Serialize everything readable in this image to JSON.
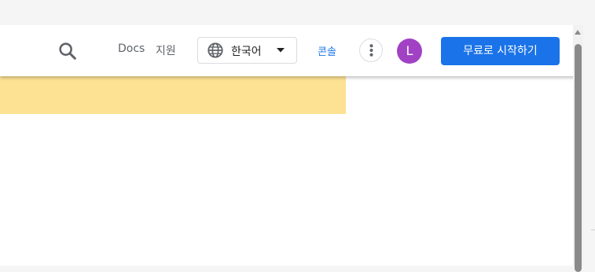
{
  "header": {
    "nav": {
      "docs": "Docs",
      "support": "지원"
    },
    "language": {
      "selected": "한국어"
    },
    "console": "콘솔",
    "avatar_initial": "L",
    "cta": "무료로 시작하기"
  },
  "colors": {
    "accent": "#1a73e8",
    "avatar_bg": "#a142c4",
    "banner_bg": "#fde293"
  },
  "icons": [
    "search-icon",
    "globe-icon",
    "caret-down-icon",
    "more-vert-icon"
  ]
}
